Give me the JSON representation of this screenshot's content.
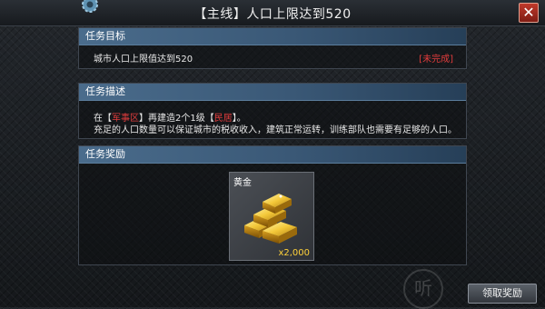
{
  "window": {
    "title": "【主线】人口上限达到520",
    "close_label": "✕"
  },
  "objective": {
    "header": "任务目标",
    "text": "城市人口上限值达到520",
    "status": "[未完成]"
  },
  "description": {
    "header": "任务描述",
    "line1": {
      "prefix": "在【",
      "district": "军事区",
      "middle": "】再建造2个1级【",
      "building": "民居",
      "suffix": "】。"
    },
    "line2": "充足的人口数量可以保证城市的税收收入，建筑正常运转，训练部队也需要有足够的人口。"
  },
  "reward": {
    "header": "任务奖励",
    "item_name": "黄金",
    "item_amount": "x2,000",
    "item_icon": "gold-bars-icon"
  },
  "actions": {
    "claim_label": "领取奖励"
  },
  "colors": {
    "header_blue": "#4a6c8c",
    "status_red": "#e23c3c",
    "amount_gold": "#ffd23a"
  },
  "watermark": "听"
}
